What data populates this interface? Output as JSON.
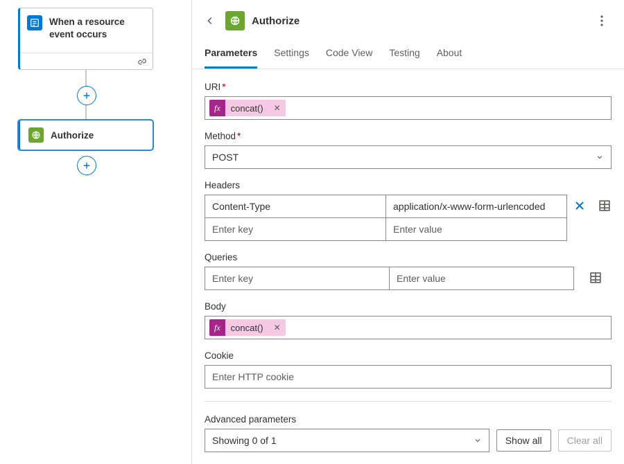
{
  "canvas": {
    "trigger_title": "When a resource event occurs",
    "action_title": "Authorize"
  },
  "panel": {
    "title": "Authorize",
    "tabs": [
      "Parameters",
      "Settings",
      "Code View",
      "Testing",
      "About"
    ],
    "active_tab": 0,
    "fields": {
      "uri": {
        "label": "URI",
        "required": true,
        "chip": "concat()"
      },
      "method": {
        "label": "Method",
        "required": true,
        "value": "POST"
      },
      "headers": {
        "label": "Headers",
        "rows": [
          {
            "key": "Content-Type",
            "value": "application/x-www-form-urlencoded"
          }
        ],
        "key_placeholder": "Enter key",
        "value_placeholder": "Enter value"
      },
      "queries": {
        "label": "Queries",
        "key_placeholder": "Enter key",
        "value_placeholder": "Enter value"
      },
      "body": {
        "label": "Body",
        "chip": "concat()"
      },
      "cookie": {
        "label": "Cookie",
        "placeholder": "Enter HTTP cookie"
      }
    },
    "advanced": {
      "label": "Advanced parameters",
      "summary": "Showing 0 of 1",
      "show_all": "Show all",
      "clear_all": "Clear all"
    }
  }
}
